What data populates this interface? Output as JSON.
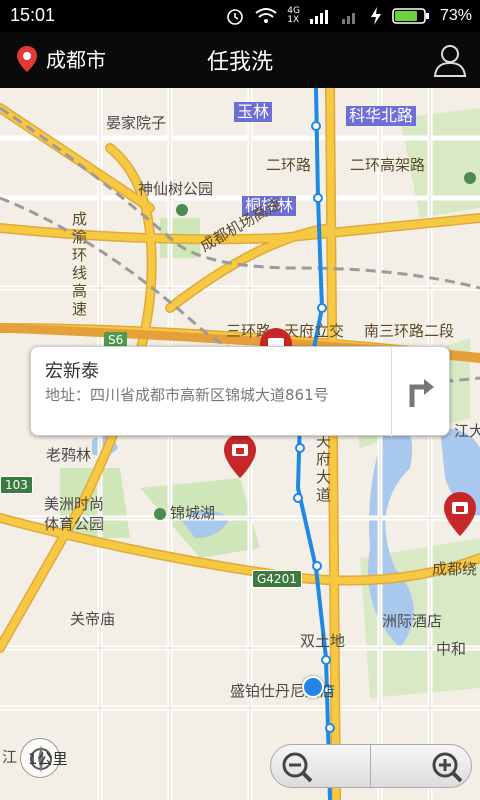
{
  "status_bar": {
    "time": "15:01",
    "network_label_top": "4G",
    "network_label_bottom": "1X",
    "battery_percent": "73%"
  },
  "header": {
    "city": "成都市",
    "title": "任我洗",
    "icons": {
      "location": "map-pin-icon",
      "user": "user-icon"
    }
  },
  "info_card": {
    "name": "宏新泰",
    "address": "地址：四川省成都市高新区锦城大道861号"
  },
  "map": {
    "tags": {
      "yulin": "玉林",
      "kehua": "科华北路",
      "tongzilin": "桐梓林"
    },
    "labels": {
      "yanjia": "晏家院子",
      "shenxianshu": "神仙树公园",
      "laoyalin": "老鸦林",
      "meizhou": "美洲时尚体育公园",
      "jinchenghu": "锦城湖",
      "guandimiao": "关帝庙",
      "zhouji": "洲际酒店",
      "zhonghe": "中和",
      "shuangtudi": "双土地",
      "shengbo": "盛铂仕丹尼酒店",
      "jiangda": "江大",
      "jiang": "江"
    },
    "roads": {
      "erhuan": "二环路",
      "erhuan_gaojia": "二环高架路",
      "chengyu": "成渝环线高速",
      "jichang": "成都机场高速",
      "sanhuan": "三环路",
      "tianfu_jiao": "天府立交",
      "nan_sanhuan": "南三环路二段",
      "tianfu_ave": "天府大道",
      "chengdu_rao": "成都绕"
    },
    "shields": {
      "s6": "S6",
      "r103": "103",
      "g4201": "G4201"
    }
  },
  "controls": {
    "scale": "1公里",
    "zoom_out_icon": "zoom-out-icon",
    "zoom_in_icon": "zoom-in-icon"
  },
  "colors": {
    "route": "#1e88e5",
    "pin": "#c62828",
    "tag": "#6d6fd6",
    "highway": "#f7c842"
  }
}
